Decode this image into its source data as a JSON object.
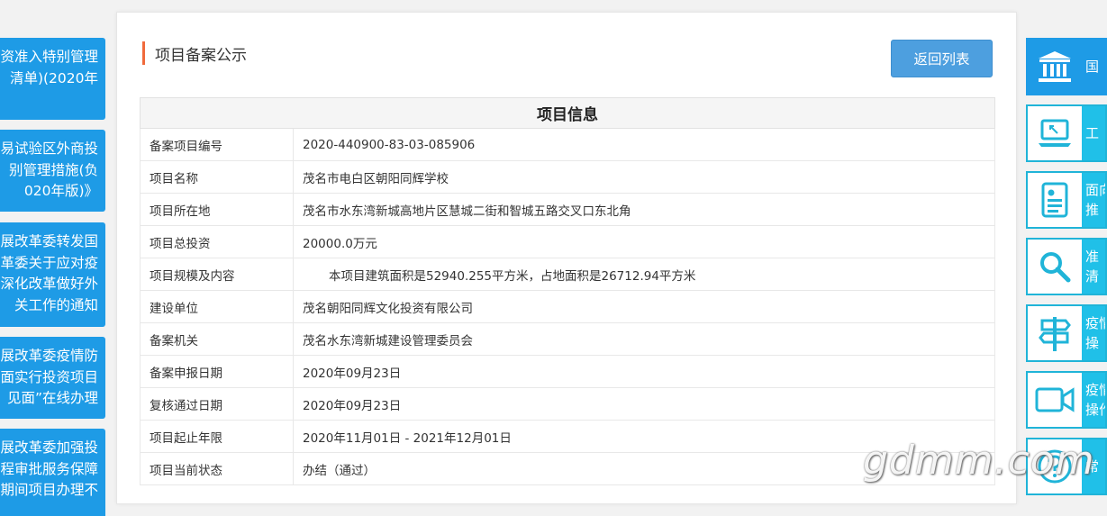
{
  "left_banners": [
    {
      "lines": [
        "资准入特别管理",
        "清单)(2020年"
      ]
    },
    {
      "lines": [
        "易试验区外商投",
        "别管理措施(负",
        "020年版)》"
      ]
    },
    {
      "lines": [
        "展改革委转发国",
        "革委关于应对疫",
        "深化改革做好外",
        "关工作的通知"
      ]
    },
    {
      "lines": [
        "展改革委疫情防",
        "面实行投资项目",
        "见面”在线办理"
      ]
    },
    {
      "lines": [
        "展改革委加强投",
        "程审批服务保障",
        "期间项目办理不"
      ]
    }
  ],
  "main": {
    "title": "项目备案公示",
    "back_button": "返回列表",
    "table_header": "项目信息",
    "rows": [
      {
        "key": "备案项目编号",
        "value": "2020-440900-83-03-085906"
      },
      {
        "key": "项目名称",
        "value": "茂名市电白区朝阳同辉学校"
      },
      {
        "key": "项目所在地",
        "value": "茂名市水东湾新城高地片区慧城二街和智城五路交叉口东北角"
      },
      {
        "key": "项目总投资",
        "value": "20000.0万元"
      },
      {
        "key": "项目规模及内容",
        "value": "本项目建筑面积是52940.255平方米，占地面积是26712.94平方米"
      },
      {
        "key": "建设单位",
        "value": "茂名朝阳同辉文化投资有限公司"
      },
      {
        "key": "备案机关",
        "value": "茂名水东湾新城建设管理委员会"
      },
      {
        "key": "备案申报日期",
        "value": "2020年09月23日"
      },
      {
        "key": "复核通过日期",
        "value": "2020年09月23日"
      },
      {
        "key": "项目起止年限",
        "value": "2020年11月01日 - 2021年12月01日"
      },
      {
        "key": "项目当前状态",
        "value": "办结（通过）"
      }
    ]
  },
  "right_nav": [
    {
      "icon": "government-building-icon",
      "lines": [
        "国"
      ]
    },
    {
      "icon": "laptop-icon",
      "lines": [
        "工"
      ]
    },
    {
      "icon": "document-list-icon",
      "lines": [
        "面向",
        "推"
      ]
    },
    {
      "icon": "magnifier-icon",
      "lines": [
        "准",
        "清"
      ]
    },
    {
      "icon": "signpost-icon",
      "lines": [
        "疫情",
        "操"
      ]
    },
    {
      "icon": "video-camera-icon",
      "lines": [
        "疫情",
        "操作"
      ]
    },
    {
      "icon": "question-icon",
      "lines": [
        "常"
      ]
    }
  ],
  "watermark": "gdmm.com"
}
